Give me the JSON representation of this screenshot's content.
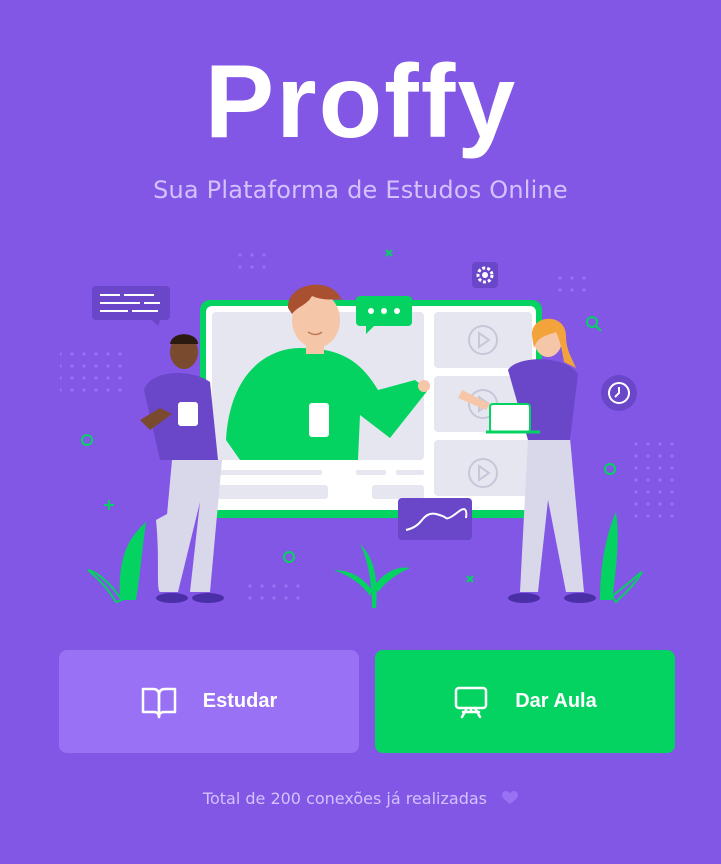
{
  "logo": {
    "text": "Proffy"
  },
  "subtitle": "Sua Plataforma de Estudos Online",
  "buttons": {
    "study_label": "Estudar",
    "give_classes_label": "Dar Aula"
  },
  "footer": {
    "connections_text": "Total de 200 conexões já realizadas",
    "heart_icon": "heart-icon"
  },
  "colors": {
    "background": "#8257e5",
    "study_button": "#9871f5",
    "give_classes_button": "#04d361",
    "subtitle_text": "#d4c2ff"
  }
}
